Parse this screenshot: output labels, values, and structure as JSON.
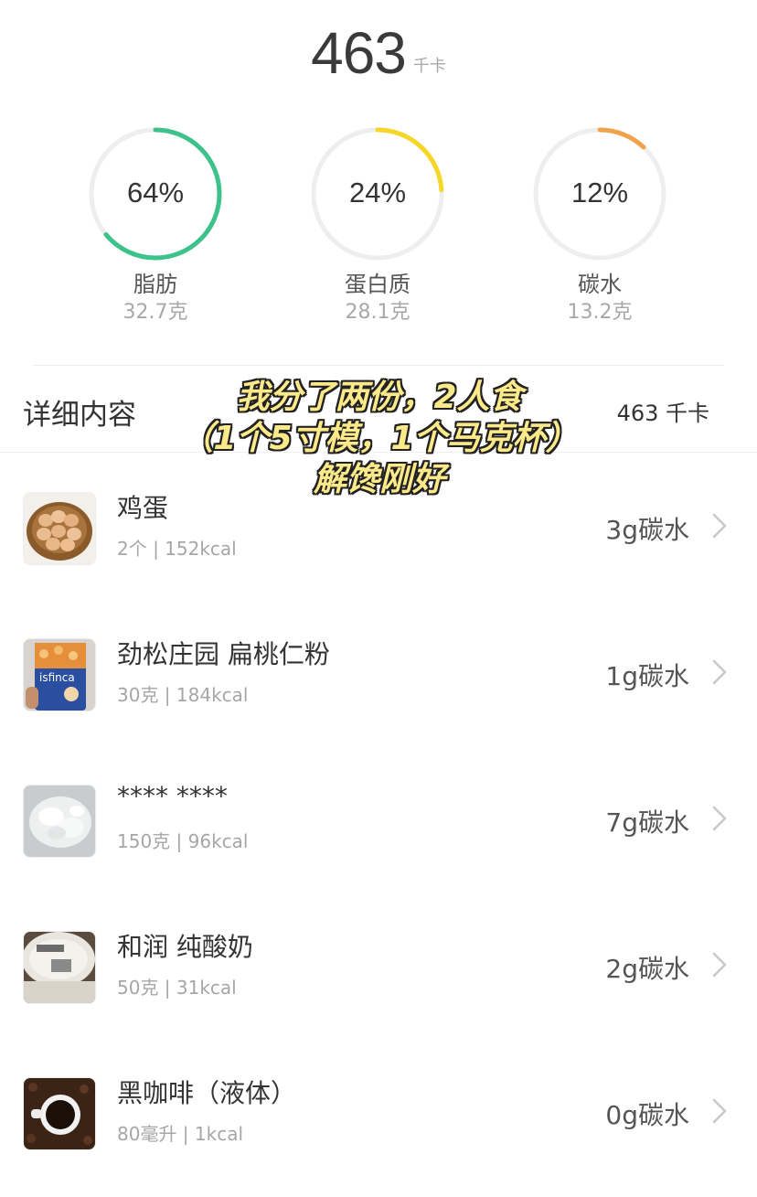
{
  "summary": {
    "total_value": "463",
    "total_unit": "千卡"
  },
  "macros": [
    {
      "percent_label": "64%",
      "percent": 0.64,
      "name": "脂肪",
      "grams": "32.7克",
      "color": "#3cc28a"
    },
    {
      "percent_label": "24%",
      "percent": 0.24,
      "name": "蛋白质",
      "grams": "28.1克",
      "color": "#f6d629"
    },
    {
      "percent_label": "12%",
      "percent": 0.12,
      "name": "碳水",
      "grams": "13.2克",
      "color": "#f1a24a"
    }
  ],
  "details": {
    "title": "详细内容",
    "total": "463 千卡"
  },
  "overlay": {
    "line1": "我分了两份，2人食",
    "line2": "（1个5寸模，1个马克杯）",
    "line3": "解馋刚好"
  },
  "foods": [
    {
      "name": "鸡蛋",
      "meta": "2个 | 152kcal",
      "carbs": "3g碳水",
      "icon": "eggs-basket-photo"
    },
    {
      "name": "劲松庄园 扁桃仁粉",
      "meta": "30克 | 184kcal",
      "carbs": "1g碳水",
      "icon": "almond-flour-bag-photo"
    },
    {
      "name": "**** ****",
      "meta": "150克 | 96kcal",
      "carbs": "7g碳水",
      "icon": "cream-cheese-photo"
    },
    {
      "name": "和润 纯酸奶",
      "meta": "50克 | 31kcal",
      "carbs": "2g碳水",
      "icon": "yogurt-cup-photo"
    },
    {
      "name": "黑咖啡（液体）",
      "meta": "80毫升 | 1kcal",
      "carbs": "0g碳水",
      "icon": "black-coffee-photo"
    }
  ],
  "ring_track_color": "#eeeeee"
}
